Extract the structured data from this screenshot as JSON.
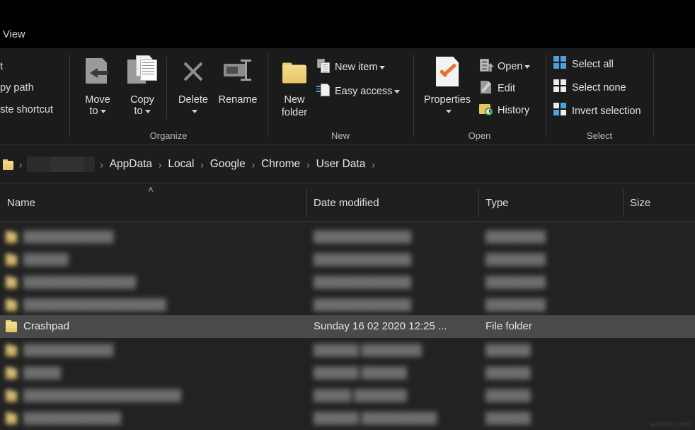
{
  "window": {
    "active_tab": "View"
  },
  "ribbon": {
    "clipboard": {
      "items": [
        {
          "label": "ut",
          "name": "cut-button"
        },
        {
          "label": "opy path",
          "name": "copy-path-button"
        },
        {
          "label": "aste shortcut",
          "name": "paste-shortcut-button"
        }
      ]
    },
    "groups": [
      {
        "label": "Organize"
      },
      {
        "label": "New"
      },
      {
        "label": "Open"
      },
      {
        "label": "Select"
      }
    ],
    "organize": {
      "move_to": {
        "line1": "Move",
        "line2": "to",
        "icon": "move-to-icon"
      },
      "copy_to": {
        "line1": "Copy",
        "line2": "to",
        "icon": "copy-to-icon"
      },
      "delete": {
        "label": "Delete",
        "icon": "delete-x-icon"
      },
      "rename": {
        "label": "Rename",
        "icon": "rename-icon"
      }
    },
    "new": {
      "new_folder": {
        "line1": "New",
        "line2": "folder",
        "icon": "new-folder-icon"
      },
      "new_item": {
        "label": "New item",
        "icon": "new-item-icon"
      },
      "easy_access": {
        "label": "Easy access",
        "icon": "easy-access-icon"
      }
    },
    "open": {
      "properties": {
        "label": "Properties",
        "icon": "properties-icon"
      },
      "open": {
        "label": "Open",
        "icon": "open-icon"
      },
      "edit": {
        "label": "Edit",
        "icon": "edit-icon"
      },
      "history": {
        "label": "History",
        "icon": "history-icon"
      }
    },
    "select": {
      "select_all": {
        "label": "Select all",
        "icon": "select-all-icon"
      },
      "select_none": {
        "label": "Select none",
        "icon": "select-none-icon"
      },
      "invert_selection": {
        "label": "Invert selection",
        "icon": "invert-selection-icon"
      }
    }
  },
  "address_bar": {
    "crumbs": [
      {
        "label": "",
        "redacted": true
      },
      {
        "label": "AppData",
        "redacted": false
      },
      {
        "label": "Local",
        "redacted": false
      },
      {
        "label": "Google",
        "redacted": false
      },
      {
        "label": "Chrome",
        "redacted": false
      },
      {
        "label": "User Data",
        "redacted": false
      }
    ],
    "separator": "›"
  },
  "columns": {
    "name": "Name",
    "date_modified": "Date modified",
    "type": "Type",
    "size": "Size",
    "sort_indicator": "˄"
  },
  "rows": [
    {
      "name": "",
      "date_modified": "",
      "type": "",
      "size": "",
      "blurred": true,
      "selected": false
    },
    {
      "name": "",
      "date_modified": "",
      "type": "",
      "size": "",
      "blurred": true,
      "selected": false
    },
    {
      "name": "",
      "date_modified": "",
      "type": "",
      "size": "",
      "blurred": true,
      "selected": false
    },
    {
      "name": "",
      "date_modified": "",
      "type": "",
      "size": "",
      "blurred": true,
      "selected": false
    },
    {
      "name": "Crashpad",
      "date_modified": "Sunday 16 02 2020 12:25 ...",
      "type": "File folder",
      "size": "",
      "blurred": false,
      "selected": true
    },
    {
      "name": "",
      "date_modified": "",
      "type": "",
      "size": "",
      "blurred": true,
      "selected": false
    },
    {
      "name": "",
      "date_modified": "",
      "type": "",
      "size": "",
      "blurred": true,
      "selected": false
    },
    {
      "name": "",
      "date_modified": "",
      "type": "",
      "size": "",
      "blurred": true,
      "selected": false
    },
    {
      "name": "",
      "date_modified": "",
      "type": "",
      "size": "",
      "blurred": true,
      "selected": false
    }
  ],
  "watermark": "wsxdn.com",
  "colors": {
    "window_bg": "#1f1f1f",
    "ribbon_bg": "#1b1b1b",
    "list_bg": "#222222",
    "selected_row": "#4a4a4a",
    "folder_yellow": "#e9c460",
    "accent_orange": "#e8702a",
    "accent_blue": "#4aa3df"
  }
}
